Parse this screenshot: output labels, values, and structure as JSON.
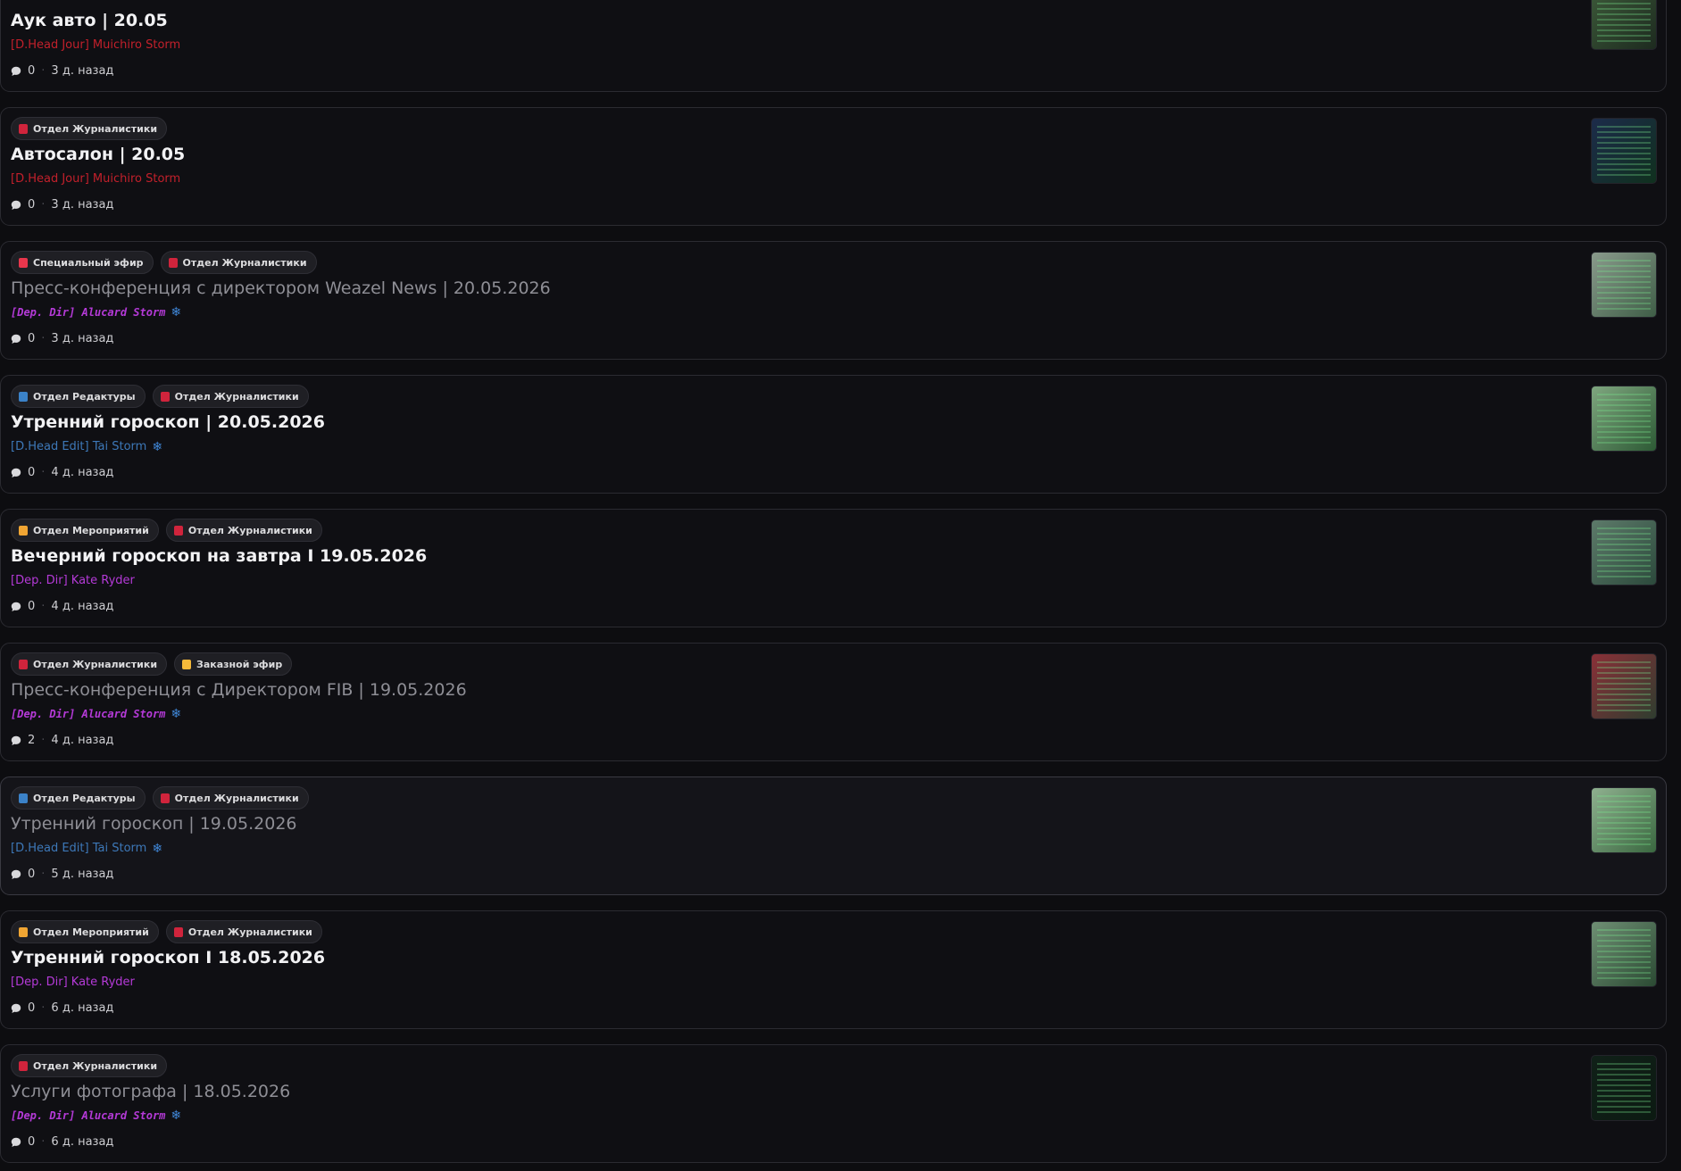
{
  "colors": {
    "journalism": "#d0243c",
    "editorial": "#3b82c8",
    "events": "#f0a533",
    "special": "#e8364c",
    "ordered": "#f5b93a",
    "author_red": "#c2202b",
    "author_purple": "#b53ad8",
    "author_blue": "#3d78b8"
  },
  "posts": [
    {
      "tags": [],
      "title": "Аук авто | 20.05",
      "title_style": "bold",
      "author": "[D.Head Jour] Muichiro Storm",
      "author_color": "#c2202b",
      "author_snowflake": false,
      "comments": "0",
      "time": "3 д. назад",
      "thumb": [
        "#3d5a3a",
        "#1d2a1f"
      ]
    },
    {
      "tags": [
        {
          "label": "Отдел Журналистики",
          "color": "#d0243c"
        }
      ],
      "title": "Автосалон | 20.05",
      "title_style": "bold",
      "author": "[D.Head Jour] Muichiro Storm",
      "author_color": "#c2202b",
      "author_snowflake": false,
      "comments": "0",
      "time": "3 д. назад",
      "thumb": [
        "#1c2b4a",
        "#10301e"
      ]
    },
    {
      "tags": [
        {
          "label": "Специальный эфир",
          "color": "#e8364c"
        },
        {
          "label": "Отдел Журналистики",
          "color": "#d0243c"
        }
      ],
      "title": "Пресс-конференция с директором Weazel News | 20.05.2026",
      "title_style": "muted",
      "author": "[Dep. Dir] Alucard Storm",
      "author_color": "#b53ad8",
      "author_snowflake": true,
      "comments": "0",
      "time": "3 д. назад",
      "thumb": [
        "#8a9a8c",
        "#3f5e47"
      ]
    },
    {
      "tags": [
        {
          "label": "Отдел Редактуры",
          "color": "#3b82c8"
        },
        {
          "label": "Отдел Журналистики",
          "color": "#d0243c"
        }
      ],
      "title": "Утренний гороскоп | 20.05.2026",
      "title_style": "bold",
      "author": "[D.Head Edit] Tai Storm",
      "author_color": "#3d78b8",
      "author_snowflake": true,
      "comments": "0",
      "time": "4 д. назад",
      "thumb": [
        "#7fa67f",
        "#2d5a35"
      ]
    },
    {
      "tags": [
        {
          "label": "Отдел Мероприятий",
          "color": "#f0a533"
        },
        {
          "label": "Отдел Журналистики",
          "color": "#d0243c"
        }
      ],
      "title": "Вечерний гороскоп на завтра I 19.05.2026",
      "title_style": "bold",
      "author": "[Dep. Dir] Kate Ryder",
      "author_color": "#b53ad8",
      "author_snowflake": false,
      "comments": "0",
      "time": "4 д. назад",
      "thumb": [
        "#5d7a6a",
        "#2c4a3c"
      ]
    },
    {
      "tags": [
        {
          "label": "Отдел Журналистики",
          "color": "#d0243c"
        },
        {
          "label": "Заказной эфир",
          "color": "#f5b93a"
        }
      ],
      "title": "Пресс-конференция с Директором FIB | 19.05.2026",
      "title_style": "muted",
      "author": "[Dep. Dir] Alucard Storm",
      "author_color": "#b53ad8",
      "author_snowflake": true,
      "comments": "2",
      "time": "4 д. назад",
      "thumb": [
        "#8a3038",
        "#2f3d2f"
      ]
    },
    {
      "tags": [
        {
          "label": "Отдел Редактуры",
          "color": "#3b82c8"
        },
        {
          "label": "Отдел Журналистики",
          "color": "#d0243c"
        }
      ],
      "title": "Утренний гороскоп | 19.05.2026",
      "title_style": "muted",
      "author": "[D.Head Edit] Tai Storm",
      "author_color": "#3d78b8",
      "author_snowflake": true,
      "comments": "0",
      "time": "5 д. назад",
      "thumb": [
        "#8fb08f",
        "#3a6840"
      ],
      "hovered": true
    },
    {
      "tags": [
        {
          "label": "Отдел Мероприятий",
          "color": "#f0a533"
        },
        {
          "label": "Отдел Журналистики",
          "color": "#d0243c"
        }
      ],
      "title": "Утренний гороскоп I 18.05.2026",
      "title_style": "bold",
      "author": "[Dep. Dir] Kate Ryder",
      "author_color": "#b53ad8",
      "author_snowflake": false,
      "comments": "0",
      "time": "6 д. назад",
      "thumb": [
        "#6f8f74",
        "#2b4a33"
      ]
    },
    {
      "tags": [
        {
          "label": "Отдел Журналистики",
          "color": "#d0243c"
        }
      ],
      "title": "Услуги фотографа | 18.05.2026",
      "title_style": "muted",
      "author": "[Dep. Dir] Alucard Storm",
      "author_color": "#b53ad8",
      "author_snowflake": true,
      "comments": "0",
      "time": "6 д. назад",
      "thumb": [
        "#102018",
        "#0c1a12"
      ]
    }
  ]
}
